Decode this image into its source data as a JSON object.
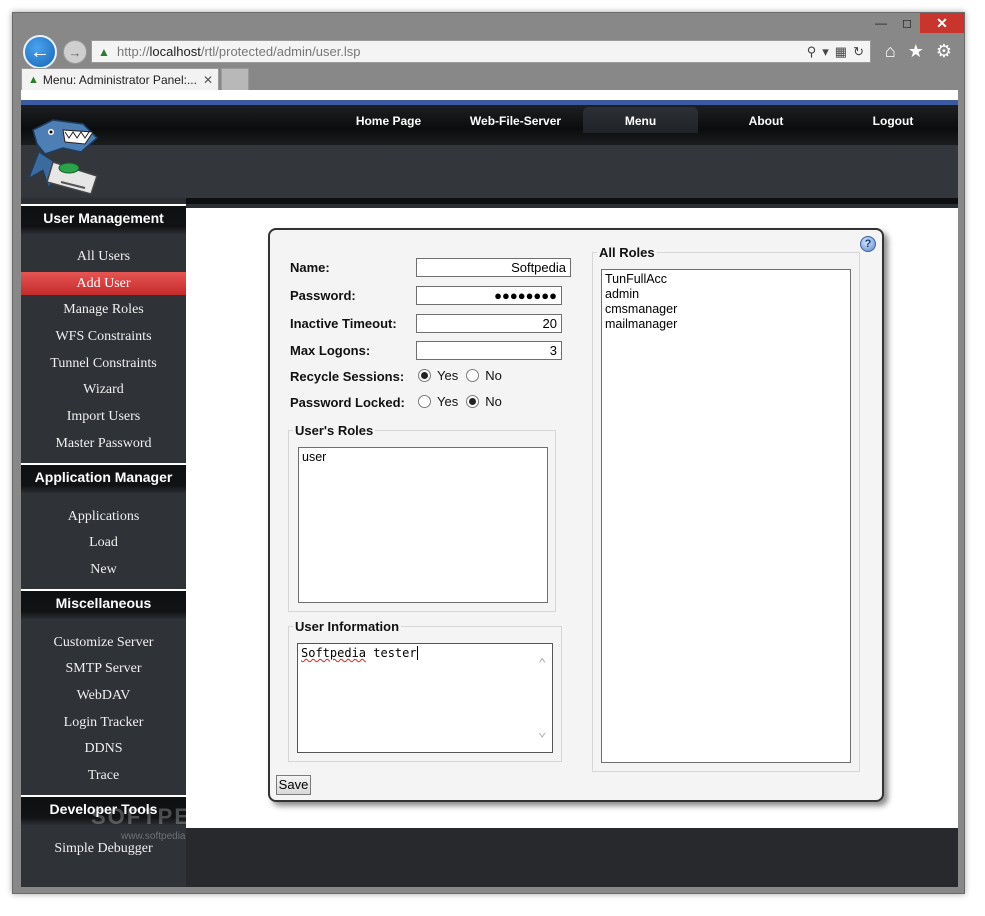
{
  "browser": {
    "url_prefix": "http://",
    "url_host": "localhost",
    "url_path": "/rtl/protected/admin/user.lsp",
    "tab_title": "Menu: Administrator Panel:...",
    "window_controls": [
      "minimize",
      "maximize",
      "close"
    ]
  },
  "topnav": {
    "items": [
      "Home Page",
      "Web-File-Server",
      "Menu",
      "About",
      "Logout"
    ],
    "active": "Menu"
  },
  "sidebar": {
    "sections": [
      {
        "title": "User Management",
        "items": [
          "All Users",
          "Add User",
          "Manage Roles",
          "WFS Constraints",
          "Tunnel Constraints",
          "Wizard",
          "Import Users",
          "Master Password"
        ]
      },
      {
        "title": "Application Manager",
        "items": [
          "Applications",
          "Load",
          "New"
        ]
      },
      {
        "title": "Miscellaneous",
        "items": [
          "Customize Server",
          "SMTP Server",
          "WebDAV",
          "Login Tracker",
          "DDNS",
          "Trace"
        ]
      },
      {
        "title": "Developer Tools",
        "items": [
          "Simple Debugger"
        ]
      }
    ],
    "active_item": "Add User"
  },
  "form": {
    "name_label": "Name:",
    "name_value": "Softpedia",
    "password_label": "Password:",
    "password_value": "●●●●●●●●",
    "timeout_label": "Inactive Timeout:",
    "timeout_value": "20",
    "max_logons_label": "Max Logons:",
    "max_logons_value": "3",
    "recycle_label": "Recycle Sessions:",
    "recycle_selected": "Yes",
    "locked_label": "Password Locked:",
    "locked_selected": "No",
    "yes_label": "Yes",
    "no_label": "No",
    "users_roles_legend": "User's Roles",
    "users_roles": [
      "user"
    ],
    "user_info_legend": "User Information",
    "user_info_word1": "Softpedia",
    "user_info_word2": " tester",
    "all_roles_legend": "All Roles",
    "all_roles": [
      "TunFullAcc",
      "admin",
      "cmsmanager",
      "mailmanager"
    ],
    "save_label": "Save"
  },
  "watermark": {
    "text": "SOFTPEDIA",
    "sub": "www.softpedia.com"
  },
  "colors": {
    "accent_active_menu": "#d43a3a",
    "nav_blue": "#3b5aa0",
    "back_button": "#1f7ad0",
    "close_button": "#c7352c"
  }
}
